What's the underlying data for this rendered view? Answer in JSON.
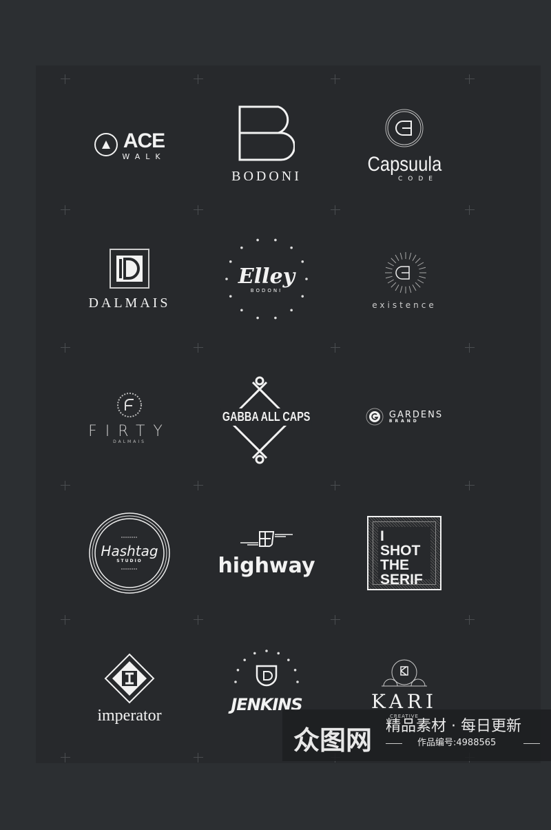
{
  "logos": {
    "ace": {
      "title": "ACE",
      "sub": "WALK"
    },
    "bodoni": {
      "title": "BODONI"
    },
    "capsuula": {
      "title": "Capsuula",
      "sub": "CODE"
    },
    "dalmais": {
      "title": "DALMAIS"
    },
    "elley": {
      "title": "Elley",
      "sub": "BODONI"
    },
    "existence": {
      "title": "existence"
    },
    "firty": {
      "title": "FIRTY",
      "sub": "DALMAIS"
    },
    "gabba": {
      "title": "GABBA ALL CAPS"
    },
    "gardens": {
      "title": "GARDENS",
      "sub": "BRAND"
    },
    "hashtag": {
      "title": "Hashtag",
      "sub": "STUDIO"
    },
    "highway": {
      "title": "highway"
    },
    "shot": {
      "line1": "I",
      "line2": "SHOT",
      "line3": "THE",
      "line4": "SERIF"
    },
    "imperator": {
      "title": "imperator"
    },
    "jenkins": {
      "title": "JENKINS"
    },
    "kari": {
      "title": "KARI",
      "sub": "CREATIVE"
    }
  },
  "watermark": {
    "brand": "众图网",
    "slogan": "精品素材 · 每日更新",
    "code": "作品编号:4988565"
  },
  "colors": {
    "background": "#2c2f32",
    "panel": "#27292c",
    "logo": "#f2f2f2"
  }
}
